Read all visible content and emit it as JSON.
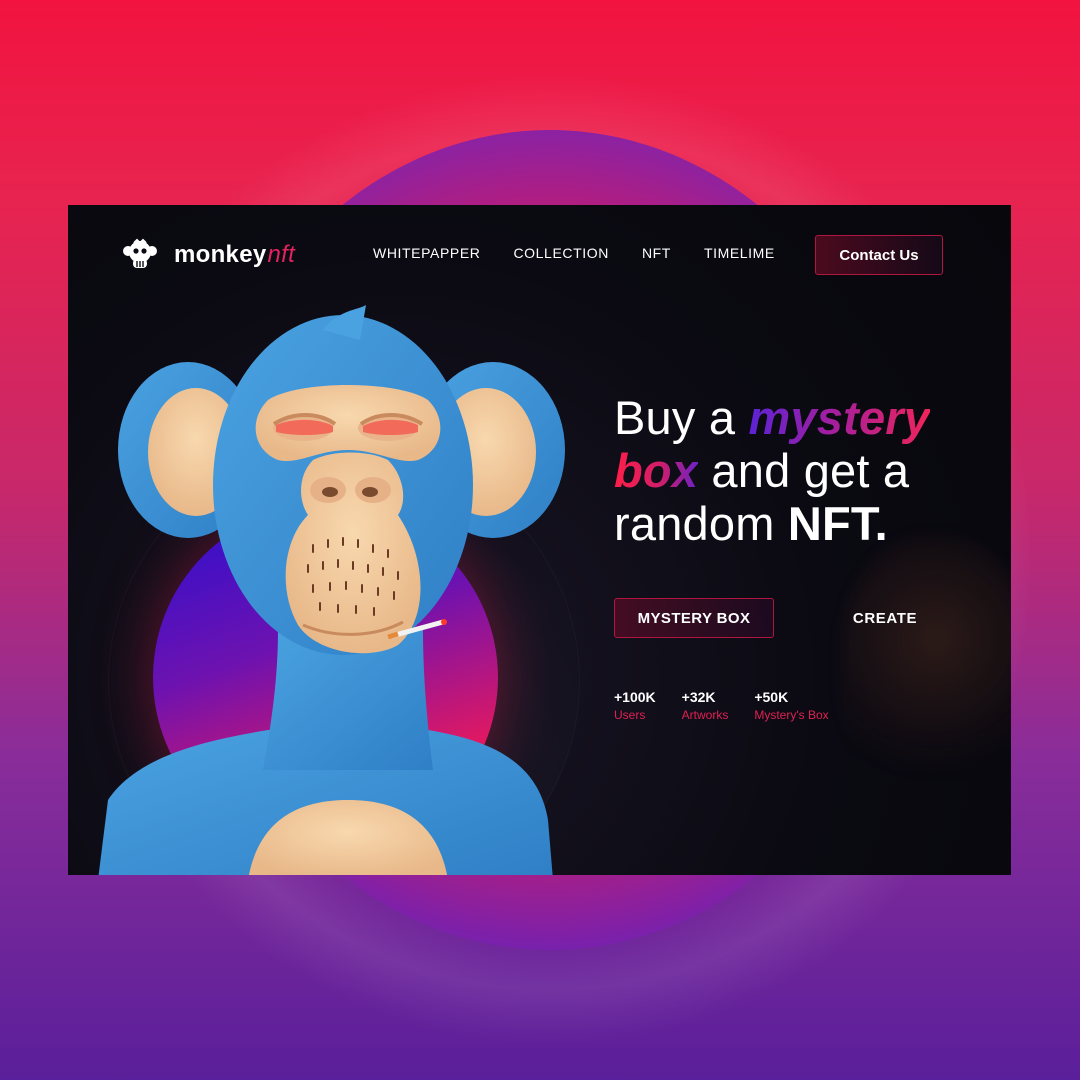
{
  "brand": {
    "name": "monkey",
    "accent": "nft"
  },
  "nav": {
    "items": [
      "WHITEPAPPER",
      "COLLECTION",
      "NFT",
      "TIMELIME"
    ]
  },
  "header": {
    "contact_label": "Contact Us"
  },
  "hero": {
    "line1_a": "Buy a ",
    "line1_b": "mystery",
    "line2_a": "box",
    "line2_b": " and get a",
    "line3_a": "random ",
    "line3_b": "NFT."
  },
  "cta": {
    "primary_label": "MYSTERY BOX",
    "secondary_label": "CREATE"
  },
  "stats": [
    {
      "value": "+100K",
      "label": "Users"
    },
    {
      "value": "+32K",
      "label": "Artworks"
    },
    {
      "value": "+50K",
      "label": "Mystery's Box"
    }
  ],
  "colors": {
    "accent": "#e0245e",
    "purple": "#5b23d6",
    "background": "#0b0a12"
  },
  "icons": {
    "logo": "monkey-skull-icon"
  }
}
